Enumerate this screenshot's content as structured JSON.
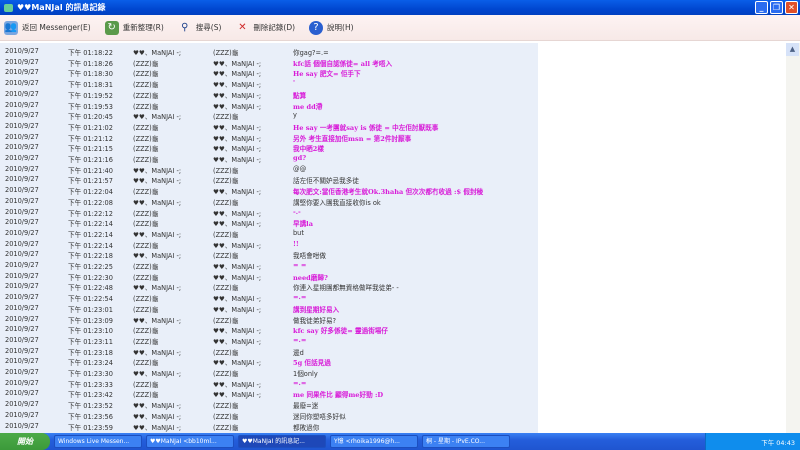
{
  "window": {
    "title": "♥♥MaNJaI 的訊息記錄",
    "minimize": "_",
    "maximize": "❐",
    "close": "✕"
  },
  "toolbar": [
    {
      "label": "返回 Messenger(E)",
      "icon": "contacts-icon"
    },
    {
      "label": "重新整理(R)",
      "icon": "refresh-icon"
    },
    {
      "label": "搜尋(S)",
      "icon": "search-icon"
    },
    {
      "label": "刪除記錄(D)",
      "icon": "delete-icon"
    },
    {
      "label": "說明(H)",
      "icon": "help-icon"
    }
  ],
  "colors": {
    "accent_pink": "#d81ad8"
  },
  "messages": [
    {
      "date": "2010/9/27",
      "time": "下午 01:18:22",
      "from": "♥♥、MaNJAI -;",
      "to": "(ZZZ)龜",
      "text": "你gag?=.=",
      "pink": false
    },
    {
      "date": "2010/9/27",
      "time": "下午 01:18:26",
      "from": "(ZZZ)龜",
      "to": "♥♥、MaNJAI -;",
      "text": "kfc話 個個自認係徒= all 考唔入",
      "pink": true
    },
    {
      "date": "2010/9/27",
      "time": "下午 01:18:30",
      "from": "(ZZZ)龜",
      "to": "♥♥、MaNJAI -;",
      "text": "He say 肥文= 佢手下",
      "pink": true
    },
    {
      "date": "2010/9/27",
      "time": "下午 01:18:31",
      "from": "(ZZZ)龜",
      "to": "♥♥、MaNJAI -;",
      "text": "'",
      "pink": true
    },
    {
      "date": "2010/9/27",
      "time": "下午 01:19:52",
      "from": "(ZZZ)龜",
      "to": "♥♥、MaNJAI -;",
      "text": "點算",
      "pink": true
    },
    {
      "date": "2010/9/27",
      "time": "下午 01:19:53",
      "from": "(ZZZ)龜",
      "to": "♥♥、MaNJAI -;",
      "text": "me dd滯",
      "pink": true
    },
    {
      "date": "2010/9/27",
      "time": "下午 01:20:45",
      "from": "♥♥、MaNJAI -;",
      "to": "(ZZZ)龜",
      "text": "y",
      "pink": false
    },
    {
      "date": "2010/9/27",
      "time": "下午 01:21:02",
      "from": "(ZZZ)龜",
      "to": "♥♥、MaNJAI -;",
      "text": "He say 一考團就say is 係徒 = 中左佢討厭既事",
      "pink": true
    },
    {
      "date": "2010/9/27",
      "time": "下午 01:21:12",
      "from": "(ZZZ)龜",
      "to": "♥♥、MaNJAI -;",
      "text": "另外 考生直接加佢msn = 第2件討厭事",
      "pink": true
    },
    {
      "date": "2010/9/27",
      "time": "下午 01:21:15",
      "from": "(ZZZ)龜",
      "to": "♥♥、MaNJAI -;",
      "text": "我中晒2樣",
      "pink": true
    },
    {
      "date": "2010/9/27",
      "time": "下午 01:21:16",
      "from": "(ZZZ)龜",
      "to": "♥♥、MaNJAI -;",
      "text": "gd?",
      "pink": true
    },
    {
      "date": "2010/9/27",
      "time": "下午 01:21:40",
      "from": "♥♥、MaNJAI -;",
      "to": "(ZZZ)龜",
      "text": "@@",
      "pink": false
    },
    {
      "date": "2010/9/27",
      "time": "下午 01:21:57",
      "from": "♥♥、MaNJAI -;",
      "to": "(ZZZ)龜",
      "text": "話左佢不關妒忌我多徒",
      "pink": false
    },
    {
      "date": "2010/9/27",
      "time": "下午 01:22:04",
      "from": "(ZZZ)龜",
      "to": "♥♥、MaNJAI -;",
      "text": "每次肥文:當佢香港考生就Ok.3haha 但次次都冇收過 :$ 假封稜",
      "pink": true
    },
    {
      "date": "2010/9/27",
      "time": "下午 01:22:08",
      "from": "♥♥、MaNJAI -;",
      "to": "(ZZZ)龜",
      "text": "講堅你要入團我直接收你is ok",
      "pink": false
    },
    {
      "date": "2010/9/27",
      "time": "下午 01:22:12",
      "from": "(ZZZ)龜",
      "to": "♥♥、MaNJAI -;",
      "text": "-.-",
      "pink": true
    },
    {
      "date": "2010/9/27",
      "time": "下午 01:22:14",
      "from": "(ZZZ)龜",
      "to": "♥♥、MaNJAI -;",
      "text": "早講la",
      "pink": true
    },
    {
      "date": "2010/9/27",
      "time": "下午 01:22:14",
      "from": "♥♥、MaNJAI -;",
      "to": "(ZZZ)龜",
      "text": "but",
      "pink": false
    },
    {
      "date": "2010/9/27",
      "time": "下午 01:22:14",
      "from": "(ZZZ)龜",
      "to": "♥♥、MaNJAI -;",
      "text": "!!",
      "pink": true
    },
    {
      "date": "2010/9/27",
      "time": "下午 01:22:18",
      "from": "♥♥、MaNJAI -;",
      "to": "(ZZZ)龜",
      "text": "我唔會咁做",
      "pink": false
    },
    {
      "date": "2010/9/27",
      "time": "下午 01:22:25",
      "from": "(ZZZ)龜",
      "to": "♥♥、MaNJAI -;",
      "text": "= =",
      "pink": true
    },
    {
      "date": "2010/9/27",
      "time": "下午 01:22:30",
      "from": "(ZZZ)龜",
      "to": "♥♥、MaNJAI -;",
      "text": "need磨歸?",
      "pink": true
    },
    {
      "date": "2010/9/27",
      "time": "下午 01:22:48",
      "from": "♥♥、MaNJAI -;",
      "to": "(ZZZ)龜",
      "text": "你連入星期團都無資格做咩我徒弟- -",
      "pink": false
    },
    {
      "date": "2010/9/27",
      "time": "下午 01:22:54",
      "from": "(ZZZ)龜",
      "to": "♥♥、MaNJAI -;",
      "text": "=.=",
      "pink": true
    },
    {
      "date": "2010/9/27",
      "time": "下午 01:23:01",
      "from": "(ZZZ)龜",
      "to": "♥♥、MaNJAI -;",
      "text": "講到星期好易入",
      "pink": true
    },
    {
      "date": "2010/9/27",
      "time": "下午 01:23:09",
      "from": "♥♥、MaNJAI -;",
      "to": "(ZZZ)龜",
      "text": "做我徒弟好易?",
      "pink": false
    },
    {
      "date": "2010/9/27",
      "time": "下午 01:23:10",
      "from": "(ZZZ)龜",
      "to": "♥♥、MaNJAI -;",
      "text": "kfc say 好多係徒= 靈過街場仔",
      "pink": true
    },
    {
      "date": "2010/9/27",
      "time": "下午 01:23:11",
      "from": "(ZZZ)龜",
      "to": "♥♥、MaNJAI -;",
      "text": "=.=",
      "pink": true
    },
    {
      "date": "2010/9/27",
      "time": "下午 01:23:18",
      "from": "♥♥、MaNJAI -;",
      "to": "(ZZZ)龜",
      "text": "邊d",
      "pink": false
    },
    {
      "date": "2010/9/27",
      "time": "下午 01:23:24",
      "from": "(ZZZ)龜",
      "to": "♥♥、MaNJAI -;",
      "text": "5g 佢話見過",
      "pink": true
    },
    {
      "date": "2010/9/27",
      "time": "下午 01:23:30",
      "from": "♥♥、MaNJAI -;",
      "to": "(ZZZ)龜",
      "text": "1個only",
      "pink": false
    },
    {
      "date": "2010/9/27",
      "time": "下午 01:23:33",
      "from": "(ZZZ)龜",
      "to": "♥♥、MaNJAI -;",
      "text": "=.=",
      "pink": true
    },
    {
      "date": "2010/9/27",
      "time": "下午 01:23:42",
      "from": "(ZZZ)龜",
      "to": "♥♥、MaNJAI -;",
      "text": "me 同果件比 顯得me好勁 :D",
      "pink": true
    },
    {
      "date": "2010/9/27",
      "time": "下午 01:23:52",
      "from": "♥♥、MaNJAI -;",
      "to": "(ZZZ)龜",
      "text": "最廢=迷",
      "pink": false
    },
    {
      "date": "2010/9/27",
      "time": "下午 01:23:56",
      "from": "♥♥、MaNJAI -;",
      "to": "(ZZZ)龜",
      "text": "迷同你塑唔多好似",
      "pink": false
    },
    {
      "date": "2010/9/27",
      "time": "下午 01:23:59",
      "from": "♥♥、MaNJAI -;",
      "to": "(ZZZ)龜",
      "text": "都敗過你",
      "pink": false
    }
  ],
  "taskbar": {
    "start": "開始",
    "tasks": [
      "Windows Live Messen...",
      "♥♥MaNJaI <bb10ml...",
      "♥♥MaNJaI 的訊息記...",
      "Y憶 <rhoika1996@h...",
      "桐 - 星期 - IPvE.CO..."
    ],
    "clock": "下午 04:43"
  },
  "scrollbar": {
    "up": "▲"
  }
}
